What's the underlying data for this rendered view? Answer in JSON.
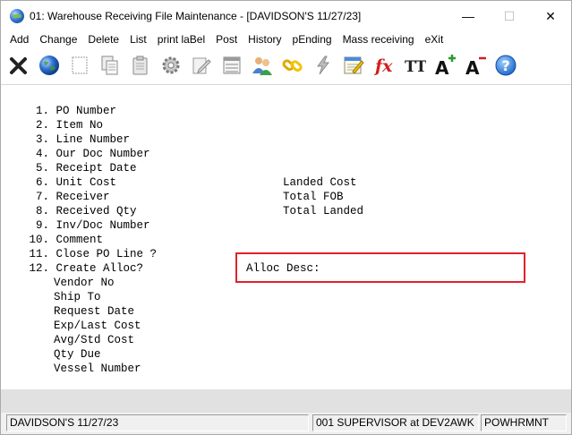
{
  "window": {
    "title": "01: Warehouse Receiving File Maintenance - [DAVIDSON'S 11/27/23]",
    "minimize_glyph": "—",
    "maximize_glyph": "☐",
    "close_glyph": "✕"
  },
  "menu": [
    "Add",
    "Change",
    "Delete",
    "List",
    "print laBel",
    "Post",
    "History",
    "pEnding",
    "Mass receiving",
    "eXit"
  ],
  "toolbar": [
    {
      "name": "close-x-icon"
    },
    {
      "name": "globe-icon"
    },
    {
      "name": "blank-page-icon"
    },
    {
      "name": "copy-icon"
    },
    {
      "name": "paste-icon"
    },
    {
      "name": "settings-gear-icon"
    },
    {
      "name": "edit-page-icon"
    },
    {
      "name": "list-view-icon"
    },
    {
      "name": "users-icon"
    },
    {
      "name": "chain-link-icon"
    },
    {
      "name": "lightning-icon"
    },
    {
      "name": "calendar-edit-icon"
    },
    {
      "name": "function-fx-icon"
    },
    {
      "name": "font-size-icon"
    },
    {
      "name": "increase-font-icon"
    },
    {
      "name": "decrease-font-icon"
    },
    {
      "name": "help-icon"
    }
  ],
  "toolbar_text": {
    "fx": "fx",
    "tt": "TT",
    "a_plus": "A",
    "a_minus": "A",
    "help": "?"
  },
  "form": {
    "fields": [
      {
        "num": "1.",
        "label": "PO Number"
      },
      {
        "num": "2.",
        "label": "Item No"
      },
      {
        "num": "3.",
        "label": "Line Number"
      },
      {
        "num": "4.",
        "label": "Our Doc Number"
      },
      {
        "num": "5.",
        "label": "Receipt Date"
      },
      {
        "num": "6.",
        "label": "Unit Cost"
      },
      {
        "num": "7.",
        "label": "Receiver"
      },
      {
        "num": "8.",
        "label": "Received Qty"
      },
      {
        "num": "9.",
        "label": "Inv/Doc Number"
      },
      {
        "num": "10.",
        "label": "Comment"
      },
      {
        "num": "11.",
        "label": "Close PO Line ?"
      },
      {
        "num": "12.",
        "label": "Create Alloc?"
      }
    ],
    "extra_fields": [
      "Vendor No",
      "Ship To",
      "Request Date",
      "Exp/Last Cost",
      "Avg/Std Cost",
      "Qty Due",
      "Vessel Number"
    ],
    "right_labels": [
      "Landed Cost",
      "Total FOB",
      "Total Landed"
    ],
    "alloc_desc_label": "Alloc Desc:"
  },
  "status": {
    "company_date": "DAVIDSON'S 11/27/23",
    "user_info": "001 SUPERVISOR at DEV2AWK",
    "program": "POWHRMNT"
  },
  "colors": {
    "highlight": "#e0222c",
    "band": "#e1e1e1"
  }
}
